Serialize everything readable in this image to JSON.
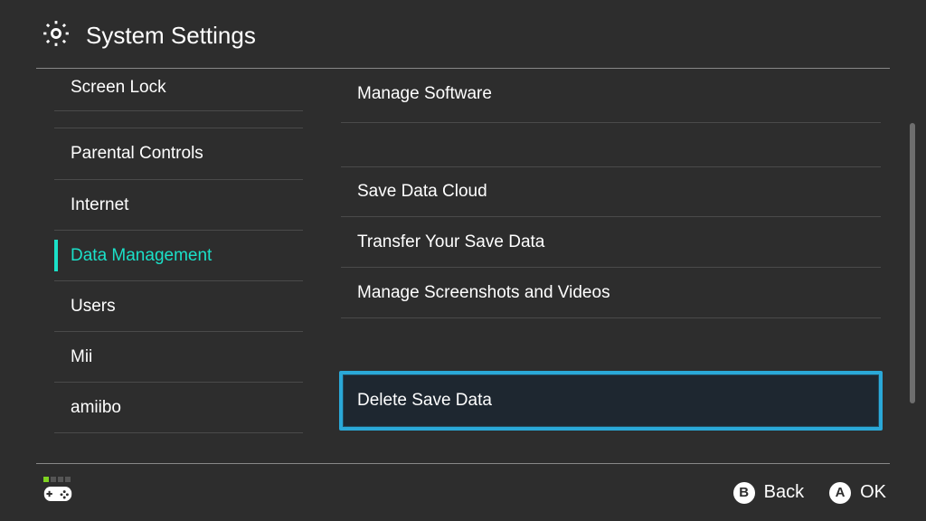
{
  "header": {
    "title": "System Settings"
  },
  "sidebar": {
    "items": [
      {
        "id": "screen-lock",
        "label": "Screen Lock",
        "selected": false
      },
      {
        "id": "parental-controls",
        "label": "Parental Controls",
        "selected": false
      },
      {
        "id": "internet",
        "label": "Internet",
        "selected": false
      },
      {
        "id": "data-management",
        "label": "Data Management",
        "selected": true
      },
      {
        "id": "users",
        "label": "Users",
        "selected": false
      },
      {
        "id": "mii",
        "label": "Mii",
        "selected": false
      },
      {
        "id": "amiibo",
        "label": "amiibo",
        "selected": false
      }
    ]
  },
  "main": {
    "items": [
      {
        "id": "manage-software",
        "label": "Manage Software",
        "highlighted": false
      },
      {
        "id": "save-data-cloud",
        "label": "Save Data Cloud",
        "highlighted": false
      },
      {
        "id": "transfer-save-data",
        "label": "Transfer Your Save Data",
        "highlighted": false
      },
      {
        "id": "manage-screenshots-videos",
        "label": "Manage Screenshots and Videos",
        "highlighted": false
      },
      {
        "id": "delete-save-data",
        "label": "Delete Save Data",
        "highlighted": true
      }
    ]
  },
  "footer": {
    "back_glyph": "B",
    "back_label": "Back",
    "ok_glyph": "A",
    "ok_label": "OK"
  }
}
